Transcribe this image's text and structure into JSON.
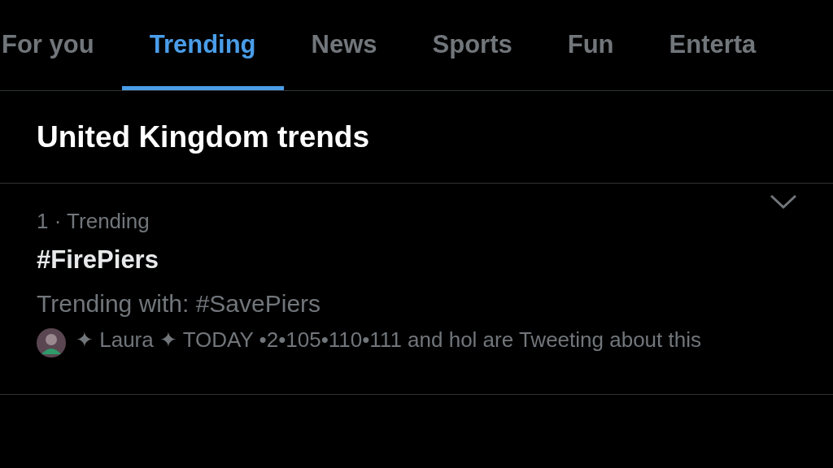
{
  "tabs": [
    {
      "label": "For you",
      "selected": false
    },
    {
      "label": "Trending",
      "selected": true
    },
    {
      "label": "News",
      "selected": false
    },
    {
      "label": "Sports",
      "selected": false
    },
    {
      "label": "Fun",
      "selected": false
    },
    {
      "label": "Enterta",
      "selected": false
    }
  ],
  "section_title": "United Kingdom trends",
  "trends": [
    {
      "meta": "1 · Trending",
      "hashtag": "#FirePiers",
      "trending_with": "Trending with: #SavePiers",
      "social_context": "✦ Laura ✦ TODAY •2•105•110•111 and hol are Tweeting about this"
    }
  ]
}
